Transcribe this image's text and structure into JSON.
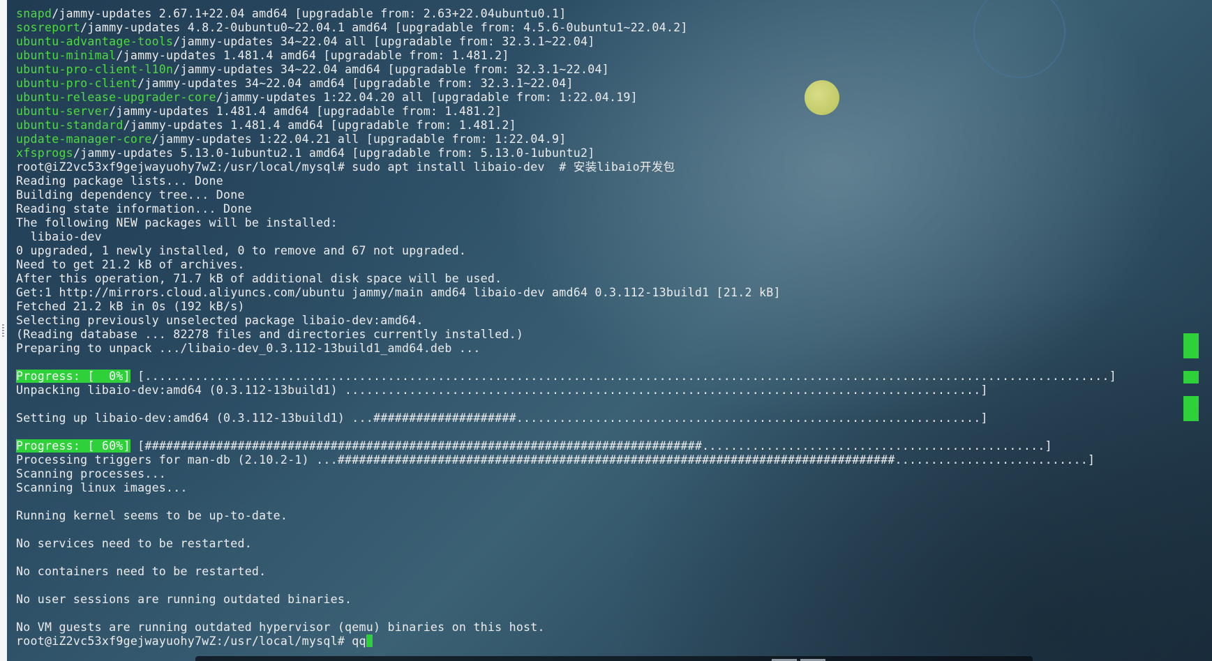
{
  "terminal": {
    "lines": [
      {
        "pkg": "snapd",
        "text": "/jammy-updates 2.67.1+22.04 amd64 [upgradable from: 2.63+22.04ubuntu0.1]"
      },
      {
        "pkg": "sosreport",
        "text": "/jammy-updates 4.8.2-0ubuntu0~22.04.1 amd64 [upgradable from: 4.5.6-0ubuntu1~22.04.2]"
      },
      {
        "pkg": "ubuntu-advantage-tools",
        "text": "/jammy-updates 34~22.04 all [upgradable from: 32.3.1~22.04]"
      },
      {
        "pkg": "ubuntu-minimal",
        "text": "/jammy-updates 1.481.4 amd64 [upgradable from: 1.481.2]"
      },
      {
        "pkg": "ubuntu-pro-client-l10n",
        "text": "/jammy-updates 34~22.04 amd64 [upgradable from: 32.3.1~22.04]"
      },
      {
        "pkg": "ubuntu-pro-client",
        "text": "/jammy-updates 34~22.04 amd64 [upgradable from: 32.3.1~22.04]"
      },
      {
        "pkg": "ubuntu-release-upgrader-core",
        "text": "/jammy-updates 1:22.04.20 all [upgradable from: 1:22.04.19]"
      },
      {
        "pkg": "ubuntu-server",
        "text": "/jammy-updates 1.481.4 amd64 [upgradable from: 1.481.2]"
      },
      {
        "pkg": "ubuntu-standard",
        "text": "/jammy-updates 1.481.4 amd64 [upgradable from: 1.481.2]"
      },
      {
        "pkg": "update-manager-core",
        "text": "/jammy-updates 1:22.04.21 all [upgradable from: 1:22.04.9]"
      },
      {
        "pkg": "xfsprogs",
        "text": "/jammy-updates 5.13.0-1ubuntu2.1 amd64 [upgradable from: 5.13.0-1ubuntu2]"
      },
      {
        "text": "root@iZ2vc53xf9gejwayuohy7wZ:/usr/local/mysql# sudo apt install libaio-dev  # 安装libaio开发包"
      },
      {
        "text": "Reading package lists... Done"
      },
      {
        "text": "Building dependency tree... Done"
      },
      {
        "text": "Reading state information... Done"
      },
      {
        "text": "The following NEW packages will be installed:"
      },
      {
        "text": "  libaio-dev"
      },
      {
        "text": "0 upgraded, 1 newly installed, 0 to remove and 67 not upgraded."
      },
      {
        "text": "Need to get 21.2 kB of archives."
      },
      {
        "text": "After this operation, 71.7 kB of additional disk space will be used."
      },
      {
        "text": "Get:1 http://mirrors.cloud.aliyuncs.com/ubuntu jammy/main amd64 libaio-dev amd64 0.3.112-13build1 [21.2 kB]"
      },
      {
        "text": "Fetched 21.2 kB in 0s (192 kB/s)"
      },
      {
        "text": "Selecting previously unselected package libaio-dev:amd64."
      },
      {
        "text": "(Reading database ... 82278 files and directories currently installed.)"
      },
      {
        "text": "Preparing to unpack .../libaio-dev_0.3.112-13build1_amd64.deb ..."
      },
      {
        "text": ""
      },
      {
        "progress": "Progress: [  0%]",
        "text": " [.......................................................................................................................................]"
      },
      {
        "text": "Unpacking libaio-dev:amd64 (0.3.112-13build1) .........................................................................................]"
      },
      {
        "text": ""
      },
      {
        "text": "Setting up libaio-dev:amd64 (0.3.112-13build1) ...####################.................................................................]"
      },
      {
        "text": ""
      },
      {
        "progress": "Progress: [ 60%]",
        "text": " [##############################################################################................................................]"
      },
      {
        "text": "Processing triggers for man-db (2.10.2-1) ...##############################################################################...........................]"
      },
      {
        "text": "Scanning processes..."
      },
      {
        "text": "Scanning linux images..."
      },
      {
        "text": ""
      },
      {
        "text": "Running kernel seems to be up-to-date."
      },
      {
        "text": ""
      },
      {
        "text": "No services need to be restarted."
      },
      {
        "text": ""
      },
      {
        "text": "No containers need to be restarted."
      },
      {
        "text": ""
      },
      {
        "text": "No user sessions are running outdated binaries."
      },
      {
        "text": ""
      },
      {
        "text": "No VM guests are running outdated hypervisor (qemu) binaries on this host."
      },
      {
        "text": "root@iZ2vc53xf9gejwayuohy7wZ:/usr/local/mysql# qq",
        "cursor": true
      }
    ]
  },
  "colors": {
    "package_name": "#4ddc3c",
    "progress_highlight": "#2ed13a",
    "foreground": "#ececec"
  }
}
